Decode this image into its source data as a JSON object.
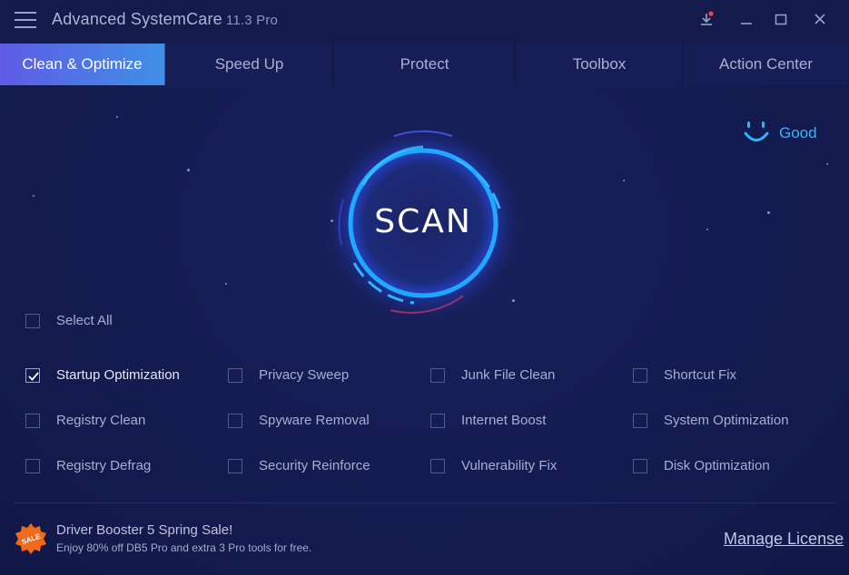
{
  "app": {
    "title": "Advanced SystemCare",
    "version": "11.3 Pro"
  },
  "tabs": [
    {
      "label": "Clean & Optimize",
      "active": true
    },
    {
      "label": "Speed Up",
      "active": false
    },
    {
      "label": "Protect",
      "active": false
    },
    {
      "label": "Toolbox",
      "active": false
    },
    {
      "label": "Action Center",
      "active": false
    }
  ],
  "status": {
    "label": "Good",
    "icon": "smile-icon",
    "color": "#2fb6ff"
  },
  "scan": {
    "label": "SCAN",
    "ring_color": "#1fa8ff"
  },
  "select_all": {
    "label": "Select All",
    "checked": false
  },
  "items": [
    {
      "label": "Startup Optimization",
      "checked": true
    },
    {
      "label": "Privacy Sweep",
      "checked": false
    },
    {
      "label": "Junk File Clean",
      "checked": false
    },
    {
      "label": "Shortcut Fix",
      "checked": false
    },
    {
      "label": "Registry Clean",
      "checked": false
    },
    {
      "label": "Spyware Removal",
      "checked": false
    },
    {
      "label": "Internet Boost",
      "checked": false
    },
    {
      "label": "System Optimization",
      "checked": false
    },
    {
      "label": "Registry Defrag",
      "checked": false
    },
    {
      "label": "Security Reinforce",
      "checked": false
    },
    {
      "label": "Vulnerability Fix",
      "checked": false
    },
    {
      "label": "Disk Optimization",
      "checked": false
    }
  ],
  "promo": {
    "badge": "SALE",
    "title": "Driver Booster 5 Spring Sale!",
    "subtitle": "Enjoy 80% off DB5 Pro and extra 3 Pro tools for free."
  },
  "footer": {
    "manage_license": "Manage License"
  },
  "colors": {
    "background": "#141b4f",
    "tab_active_start": "#5f5be6",
    "tab_active_end": "#3f8fe6",
    "sale_badge": "#f06a1a"
  }
}
